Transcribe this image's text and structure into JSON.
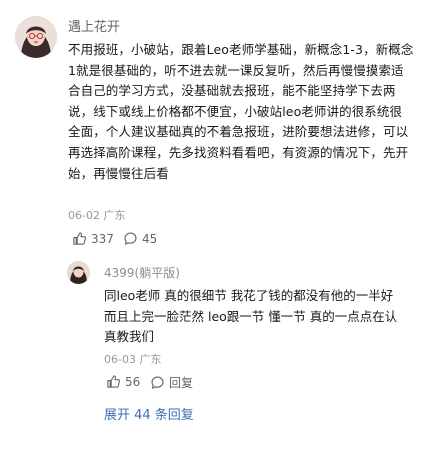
{
  "comment": {
    "username": "遇上花开",
    "text": "不用报班，小破站，跟着Leo老师学基础，新概念1-3，新概念1就是很基础的，听不进去就一课反复听，然后再慢慢摸索适合自己的学习方式，没基础就去报班，能不能坚持学下去两说，线下或线上价格都不便宜，小破站leo老师讲的很系统很全面，个人建议基础真的不着急报班，进阶要想法进修，可以再选择高阶课程，先多找资料看看吧，有资源的情况下，先开始，再慢慢往后看",
    "date_location": "06-02 广东",
    "like_count": "337",
    "comment_count": "45"
  },
  "reply": {
    "username": "4399(躺平版)",
    "text": "同leo老师 真的很细节 我花了钱的都没有他的一半好 而且上完一脸茫然 leo跟一节 懂一节 真的一点点在认真教我们",
    "date_location": "06-03 广东",
    "like_count": "56",
    "reply_label": "回复"
  },
  "expand_label": "展开 44 条回复",
  "icons": {
    "like": "thumbs-up-icon",
    "comment": "comment-bubble-icon"
  }
}
